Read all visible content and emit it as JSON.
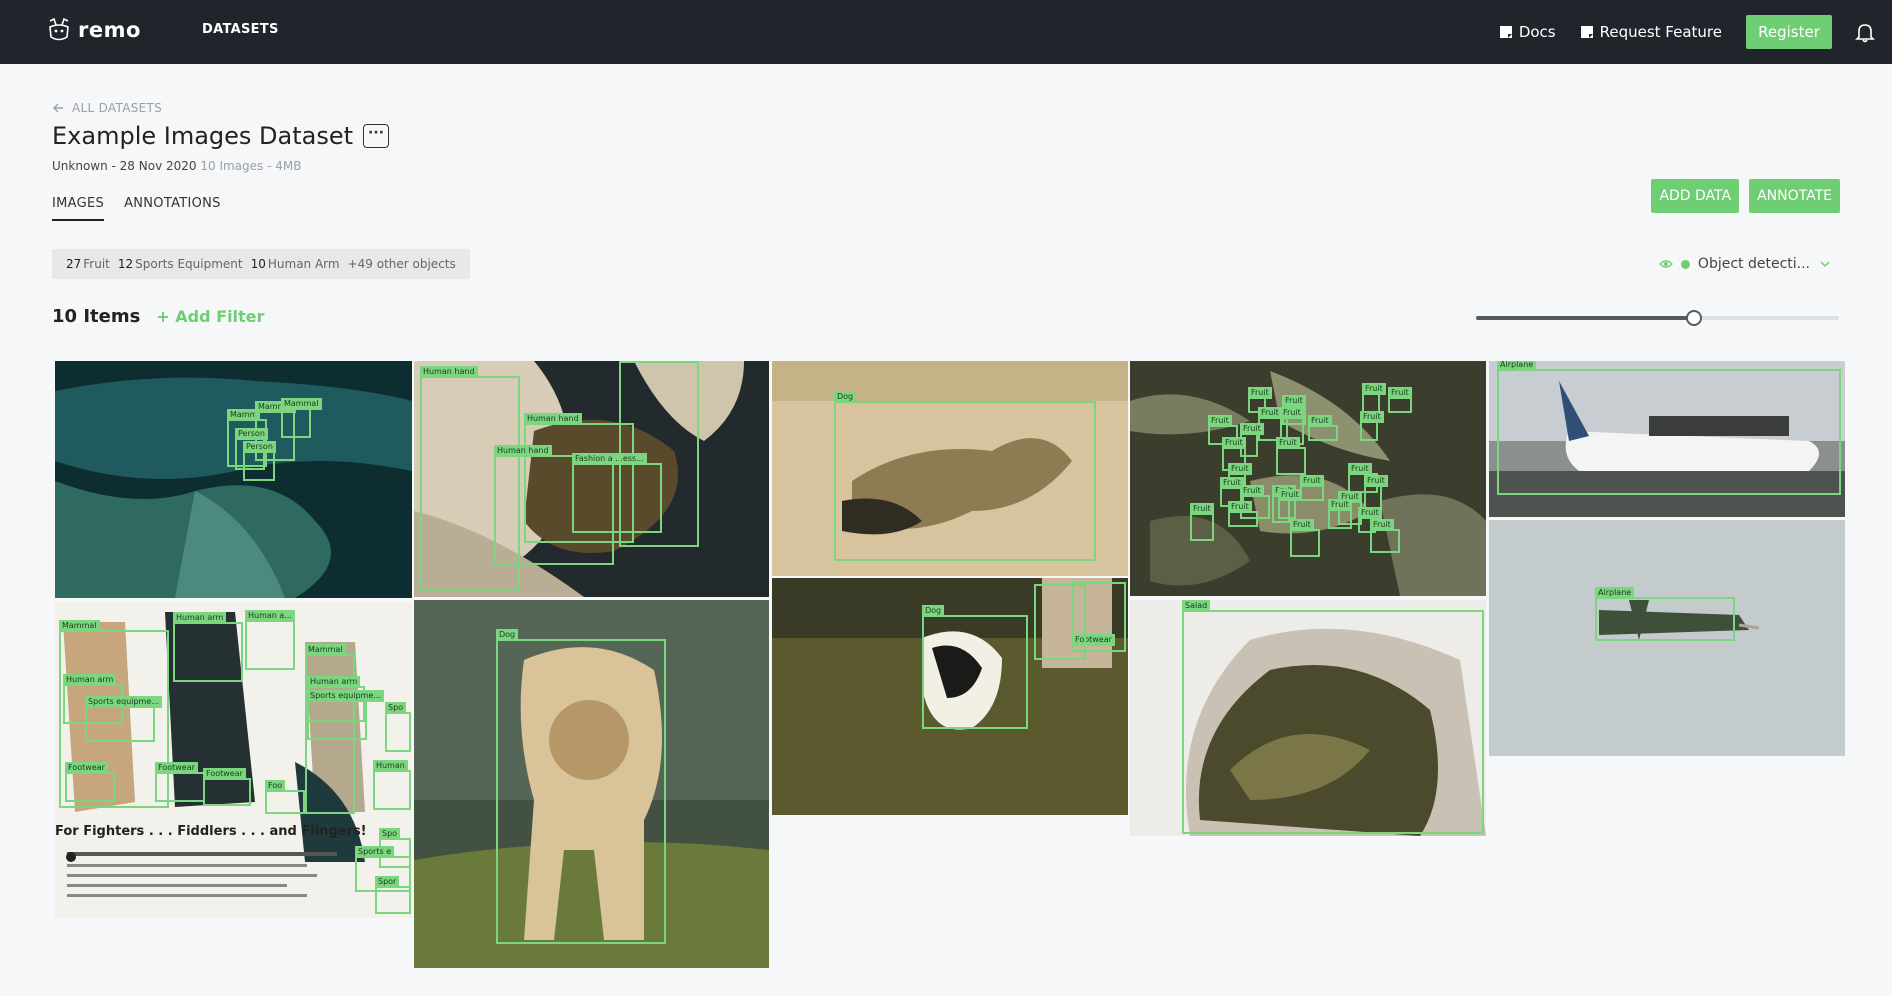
{
  "nav": {
    "brand": "remo",
    "datasets": "DATASETS",
    "docs": "Docs",
    "request_feature": "Request Feature",
    "register": "Register"
  },
  "header": {
    "back": "ALL DATASETS",
    "title": "Example Images Dataset",
    "more": "···",
    "meta_author": "Unknown - 28 Nov 2020",
    "meta_info": "10 Images - 4MB"
  },
  "tabs": [
    "IMAGES",
    "ANNOTATIONS"
  ],
  "actions": {
    "add_data": "ADD DATA",
    "annotate": "ANNOTATE"
  },
  "summary": {
    "items": [
      {
        "count": "27",
        "label": "Fruit"
      },
      {
        "count": "12",
        "label": "Sports Equipment"
      },
      {
        "count": "10",
        "label": "Human Arm"
      }
    ],
    "other": "+49 other objects"
  },
  "mode": {
    "label": "Object detecti..."
  },
  "list": {
    "count": "10 Items",
    "add_filter": "+ Add Filter"
  },
  "slider": {
    "value": 0.6
  },
  "colors": {
    "accent": "#6fce73",
    "topbar": "#20252c"
  },
  "poster_headline": "For Fighters . . . Fiddlers . . . and Flingers!",
  "images": [
    {
      "name": "cave",
      "labels": [
        "Mammal",
        "Mamm",
        "Mammal",
        "Person",
        "Person",
        "Person"
      ]
    },
    {
      "name": "fighters",
      "labels": [
        "Mammal",
        "Human arm",
        "Human a...",
        "Mammal",
        "Human arm",
        "Sports equipme...",
        "Mammal",
        "Human arm",
        "Sports equipme...",
        "Footwear",
        "Footwear",
        "Footwear",
        "Foo",
        "Spo",
        "Human",
        "Spo",
        "Sports e",
        "Spor"
      ]
    },
    {
      "name": "hands",
      "labels": [
        "Human hand",
        "Human hand",
        "Human hand",
        "Fashion a ...ess..."
      ]
    },
    {
      "name": "dog-walking",
      "labels": [
        "Dog"
      ]
    },
    {
      "name": "dog-lying",
      "labels": [
        "Dog"
      ]
    },
    {
      "name": "dog-running",
      "labels": [
        "Dog",
        "Footwear"
      ]
    },
    {
      "name": "fruit-tree",
      "labels": [
        "Fruit",
        "Fruit",
        "Fruit",
        "Fruit",
        "Fruit",
        "Fruit",
        "Fruit",
        "Fruit",
        "Fruit",
        "Fruit",
        "Fruit",
        "Fruit",
        "Fruit",
        "Fruit",
        "Fruit",
        "Fruit",
        "Fruit",
        "Fruit",
        "Fruit",
        "Fruit"
      ]
    },
    {
      "name": "salad",
      "labels": [
        "Salad"
      ]
    },
    {
      "name": "airplane-ground",
      "labels": [
        "Airplane"
      ]
    },
    {
      "name": "airplane-sky",
      "labels": [
        "Airplane"
      ]
    }
  ]
}
